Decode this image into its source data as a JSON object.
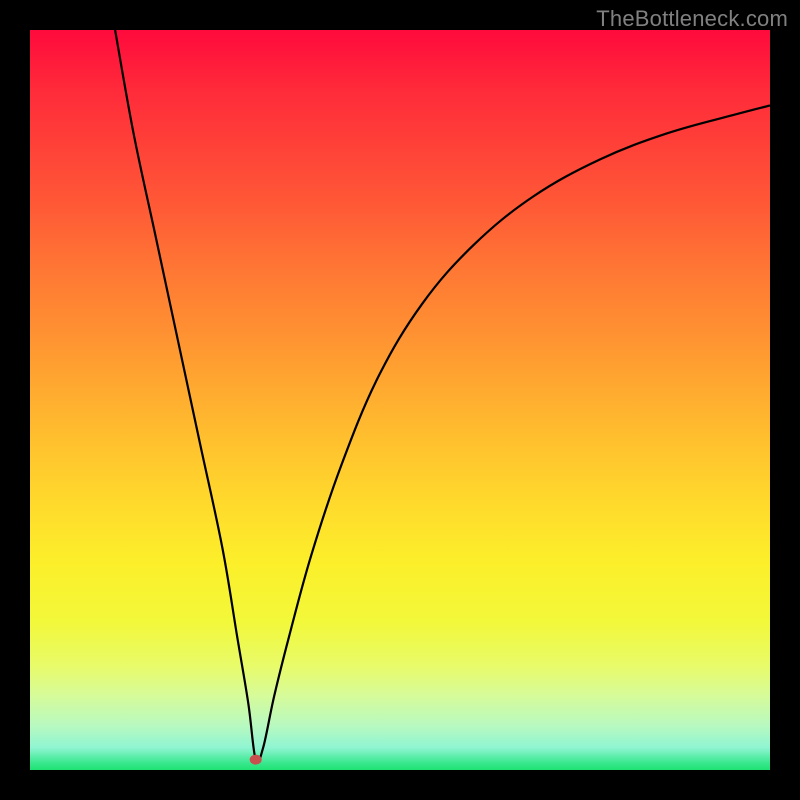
{
  "watermark": {
    "text": "TheBottleneck.com"
  },
  "chart_data": {
    "type": "line",
    "title": "",
    "xlabel": "",
    "ylabel": "",
    "xlim": [
      0,
      100
    ],
    "ylim": [
      0,
      100
    ],
    "grid": false,
    "legend": false,
    "background": "rainbow-vertical-red-to-green",
    "marker": {
      "x": 30.5,
      "y": 1.4,
      "color": "#c94e4e"
    },
    "series": [
      {
        "name": "curve",
        "x": [
          11.5,
          14,
          17,
          20,
          23,
          26,
          28,
          29.5,
          30.5,
          31.5,
          33,
          35,
          38,
          42,
          47,
          53,
          60,
          68,
          77,
          86,
          95,
          100
        ],
        "y": [
          100,
          86,
          72,
          58,
          44,
          30,
          18,
          9,
          1.4,
          3,
          10,
          18,
          29,
          41,
          53,
          63,
          71,
          77.5,
          82.5,
          86,
          88.5,
          89.8
        ]
      }
    ]
  }
}
